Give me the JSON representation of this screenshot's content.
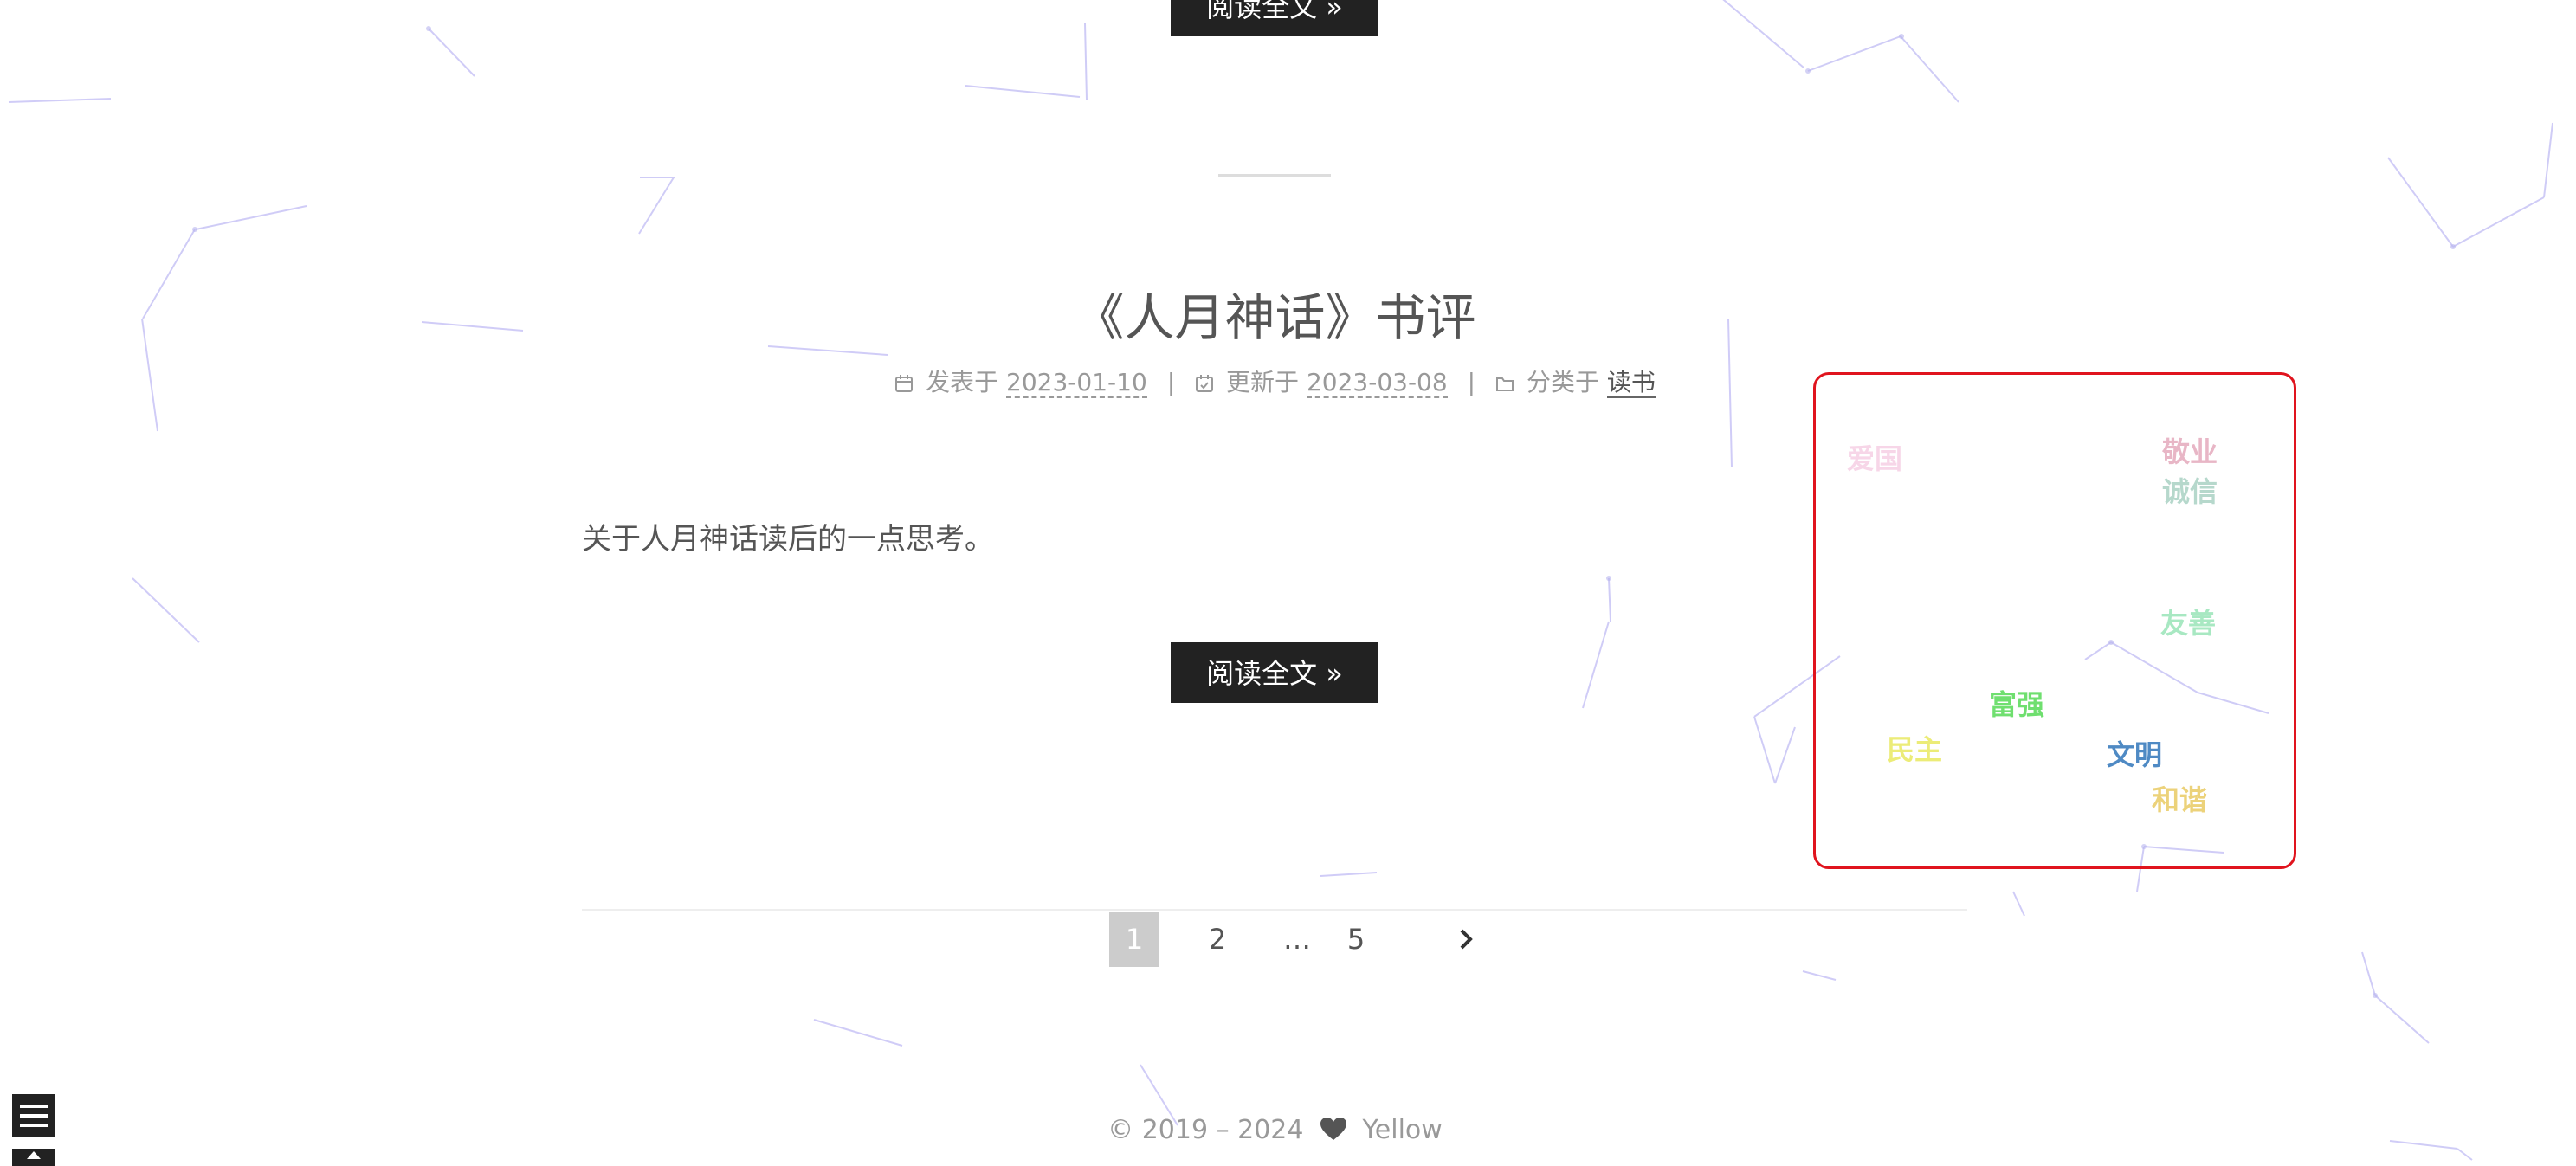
{
  "prev_post": {
    "read_more_label": "阅读全文 »"
  },
  "post": {
    "title": "《人月神话》书评",
    "meta": {
      "posted_label": "发表于",
      "posted_date": "2023-01-10",
      "updated_label": "更新于",
      "updated_date": "2023-03-08",
      "category_label": "分类于",
      "category": "读书",
      "separator": "|"
    },
    "excerpt": "关于人月神话读后的一点思考。",
    "read_more_label": "阅读全文 »"
  },
  "pagination": {
    "pages": [
      "1",
      "2",
      "…",
      "5"
    ],
    "current": "1",
    "next_icon": "chevron-right-icon"
  },
  "footer": {
    "copyright": "© 2019 – 2024",
    "icon": "heart-icon",
    "author": "Yellow"
  },
  "click_words": {
    "items": [
      {
        "text": "爱国",
        "color": "#f7d6e8"
      },
      {
        "text": "敬业",
        "color": "#e8b6c6"
      },
      {
        "text": "诚信",
        "color": "#b6d8cc"
      },
      {
        "text": "友善",
        "color": "#a8e8c2"
      },
      {
        "text": "富强",
        "color": "#6fdf6f"
      },
      {
        "text": "民主",
        "color": "#ecec78"
      },
      {
        "text": "文明",
        "color": "#4f8ac4"
      },
      {
        "text": "和谐",
        "color": "#ecd27a"
      }
    ]
  },
  "sidebar": {
    "toggle_icon": "menu-icon",
    "back_to_top_icon": "arrow-up-icon"
  },
  "colors": {
    "button_bg": "#222222",
    "highlight_border": "#e0141e",
    "active_page_bg": "#cccccc"
  }
}
